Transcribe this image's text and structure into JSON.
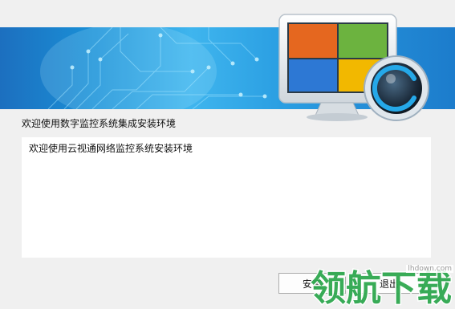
{
  "header": {
    "welcome_text": "欢迎使用数字监控系统集成安装环境"
  },
  "content": {
    "text_area_value": "欢迎使用云视通网络监控系统安装环境"
  },
  "footer": {
    "install_label": "安装",
    "exit_label": "退出"
  },
  "watermark": {
    "brand_text": "领航下载",
    "domain_text": "lhdown.com"
  },
  "colors": {
    "banner_dark": "#1c6fbf",
    "banner_light": "#3fb5ee",
    "window_bg": "#f0f0f0",
    "watermark_green": "#2fa84f"
  }
}
